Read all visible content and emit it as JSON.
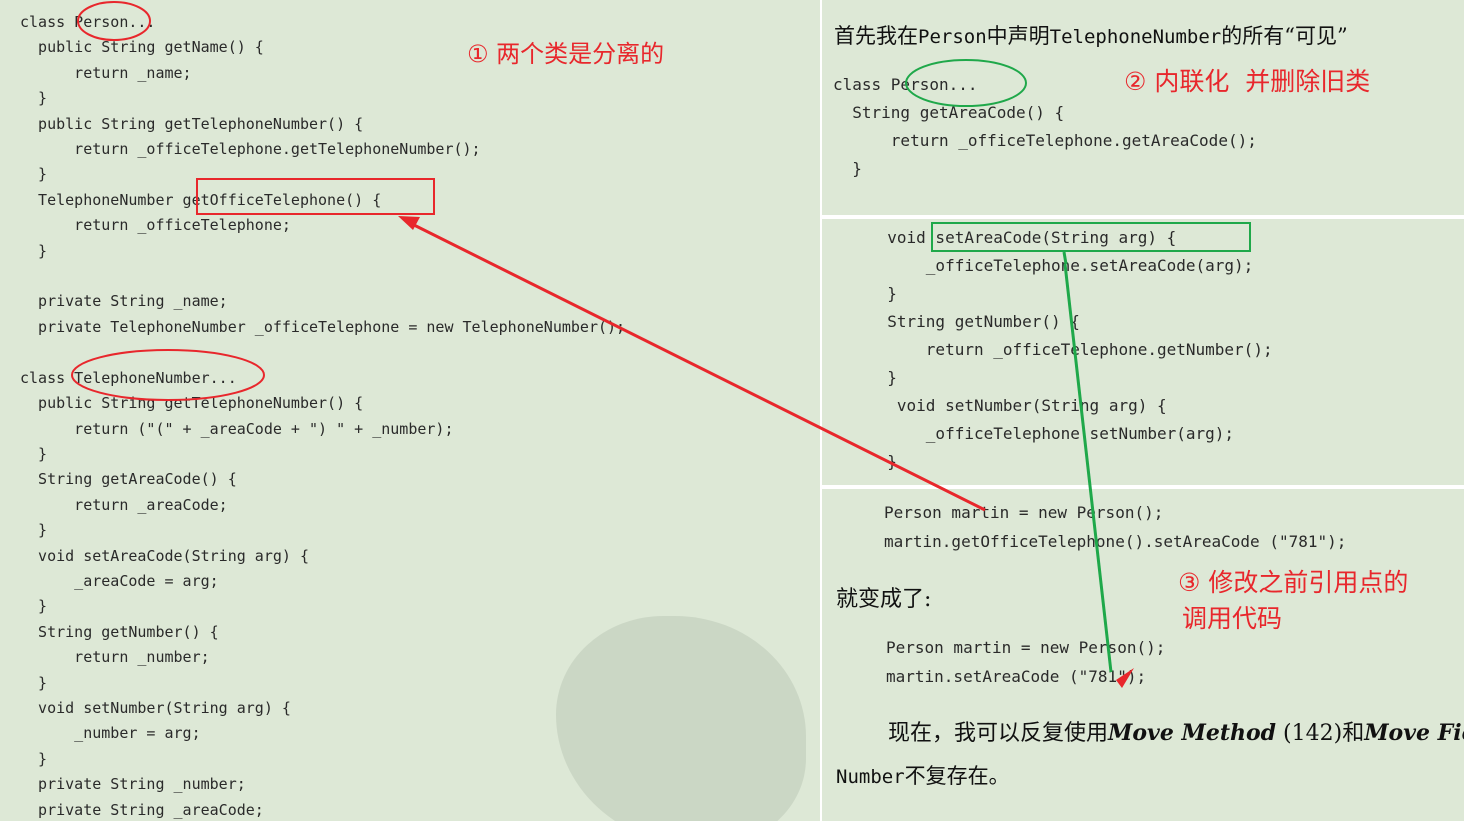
{
  "left_code": [
    "class Person...",
    "  public String getName() {",
    "      return _name;",
    "  }",
    "  public String getTelephoneNumber() {",
    "      return _officeTelephone.getTelephoneNumber();",
    "  }",
    "  TelephoneNumber getOfficeTelephone() {",
    "      return _officeTelephone;",
    "  }",
    "",
    "  private String _name;",
    "  private TelephoneNumber _officeTelephone = new TelephoneNumber();",
    "",
    "class TelephoneNumber...",
    "  public String getTelephoneNumber() {",
    "      return (\"(\" + _areaCode + \") \" + _number);",
    "  }",
    "  String getAreaCode() {",
    "      return _areaCode;",
    "  }",
    "  void setAreaCode(String arg) {",
    "      _areaCode = arg;",
    "  }",
    "  String getNumber() {",
    "      return _number;",
    "  }",
    "  void setNumber(String arg) {",
    "      _number = arg;",
    "  }",
    "  private String _number;",
    "  private String _areaCode;"
  ],
  "annotations": {
    "note1": "① 两个类是分离的",
    "note2": "② 内联化  并删除旧类",
    "note3_line1": "③ 修改之前引用点的",
    "note3_line2": "调用代码"
  },
  "right_top": {
    "intro_cn1": "首先我在",
    "intro_code1": "Person",
    "intro_cn2": "中声明",
    "intro_code2": "TelephoneNumber",
    "intro_cn3": "的所有“可见”",
    "code": [
      "class Person...",
      "  String getAreaCode() {",
      "      return _officeTelephone.getAreaCode();",
      "  }"
    ]
  },
  "right_mid": {
    "code": [
      "  void setAreaCode(String arg) {",
      "      _officeTelephone.setAreaCode(arg);",
      "  }",
      "  String getNumber() {",
      "      return _officeTelephone.getNumber();",
      "  }",
      "   void setNumber(String arg) {",
      "      _officeTelephone.setNumber(arg);",
      "  }"
    ]
  },
  "right_bot": {
    "code_before": [
      "Person martin = new Person();",
      "martin.getOfficeTelephone().setAreaCode (\"781\");"
    ],
    "becomes": "就变成了:",
    "code_after": [
      "Person martin = new Person();",
      "martin.setAreaCode (\"781\");"
    ],
    "para_cn1": "现在，我可以反复使用",
    "para_it1": "Move Method",
    "para_num": " (142)和",
    "para_it2": "Move Field",
    "last_code": "Number",
    "last_cn": "不复存在。"
  },
  "colors": {
    "panel_bg": "#dde8d6",
    "annotation_red": "#e8272c",
    "annotation_green": "#1fa84a",
    "code_text": "#2a2a2a"
  }
}
